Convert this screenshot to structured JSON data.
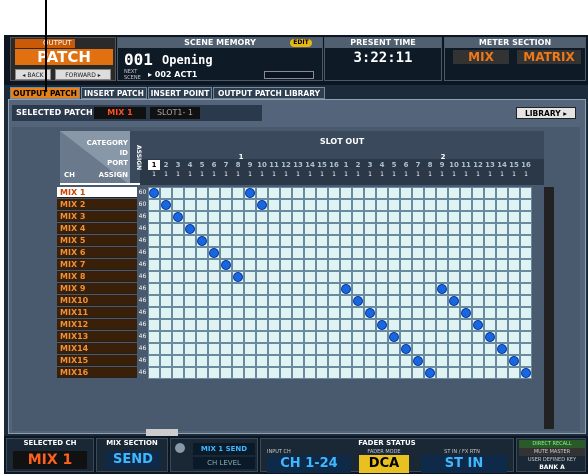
{
  "top": {
    "output_label": "OUTPUT",
    "output_title": "PATCH",
    "back_label": "◂ BACK",
    "forward_label": "FORWARD ▸",
    "scene_memory_label": "SCENE MEMORY",
    "edit_badge": "EDIT",
    "scene_number": "001",
    "scene_name": "Opening",
    "next_scene_label": "NEXT SCENE",
    "next_scene_value": "▸ 002 ACT1",
    "present_time_label": "PRESENT TIME",
    "present_time_value": "3:22:11",
    "meter_section_label": "METER SECTION",
    "meter_mix": "MIX",
    "meter_matrix": "MATRIX"
  },
  "tabs": [
    "OUTPUT PATCH",
    "INSERT PATCH",
    "INSERT POINT",
    "OUTPUT PATCH LIBRARY"
  ],
  "selected_patch": {
    "label": "SELECTED PATCH",
    "mix": "MIX 1",
    "slot": "SLOT1- 1",
    "library_button": "LIBRARY ▸"
  },
  "grid": {
    "header_labels": [
      "CATEGORY",
      "ID",
      "PORT",
      "ASSIGN"
    ],
    "ch_label": "CH",
    "assign_label": "ASSIGN",
    "slot_out_label": "SLOT OUT",
    "slot_ids": [
      "1",
      "2"
    ],
    "port_numbers": [
      "1",
      "2",
      "3",
      "4",
      "5",
      "6",
      "7",
      "8",
      "9",
      "10",
      "11",
      "12",
      "13",
      "14",
      "15",
      "16",
      "1",
      "2",
      "3",
      "4",
      "5",
      "6",
      "7",
      "8",
      "9",
      "10",
      "11",
      "12",
      "13",
      "14",
      "15",
      "16"
    ],
    "port_assigns": [
      "1",
      "1",
      "1",
      "1",
      "1",
      "1",
      "1",
      "1",
      "1",
      "1",
      "1",
      "1",
      "1",
      "1",
      "1",
      "1",
      "1",
      "1",
      "1",
      "1",
      "1",
      "1",
      "1",
      "1",
      "1",
      "1",
      "1",
      "1",
      "1",
      "1",
      "1",
      "1"
    ],
    "rows": [
      {
        "label": "MIX 1",
        "val": "60"
      },
      {
        "label": "MIX 2",
        "val": "60"
      },
      {
        "label": "MIX 3",
        "val": "46"
      },
      {
        "label": "MIX 4",
        "val": "46"
      },
      {
        "label": "MIX 5",
        "val": "46"
      },
      {
        "label": "MIX 6",
        "val": "46"
      },
      {
        "label": "MIX 7",
        "val": "46"
      },
      {
        "label": "MIX 8",
        "val": "46"
      },
      {
        "label": "MIX 9",
        "val": "46"
      },
      {
        "label": "MIX10",
        "val": "46"
      },
      {
        "label": "MIX11",
        "val": "46"
      },
      {
        "label": "MIX12",
        "val": "46"
      },
      {
        "label": "MIX13",
        "val": "46"
      },
      {
        "label": "MIX14",
        "val": "46"
      },
      {
        "label": "MIX15",
        "val": "46"
      },
      {
        "label": "MIX16",
        "val": "46"
      }
    ],
    "assignments": [
      [
        0,
        0
      ],
      [
        0,
        8
      ],
      [
        1,
        1
      ],
      [
        1,
        9
      ],
      [
        2,
        2
      ],
      [
        3,
        3
      ],
      [
        4,
        4
      ],
      [
        5,
        5
      ],
      [
        6,
        6
      ],
      [
        7,
        7
      ],
      [
        8,
        16
      ],
      [
        9,
        17
      ],
      [
        10,
        18
      ],
      [
        11,
        19
      ],
      [
        12,
        20
      ],
      [
        13,
        21
      ],
      [
        14,
        22
      ],
      [
        15,
        23
      ],
      [
        8,
        24
      ],
      [
        9,
        25
      ],
      [
        10,
        26
      ],
      [
        11,
        27
      ],
      [
        12,
        28
      ],
      [
        13,
        29
      ],
      [
        14,
        30
      ],
      [
        15,
        31
      ]
    ]
  },
  "bottom": {
    "selected_ch_label": "SELECTED CH",
    "selected_ch_value": "MIX 1",
    "mix_section_label": "MIX SECTION",
    "mix_section_value": "SEND",
    "mix1_send": "MIX 1 SEND",
    "ch_level": "CH LEVEL",
    "fader_status_label": "FADER STATUS",
    "input_ch_label": "INPUT CH",
    "input_ch_value": "CH 1-24",
    "fader_mode_label": "FADER MODE",
    "fader_mode_value": "DCA",
    "st_in_label": "ST IN / FX RTN",
    "st_in_value": "ST IN",
    "direct_recall": "DIRECT RECALL",
    "mute_master": "MUTE MASTER",
    "user_defined": "USER DEFINED KEY",
    "bank": "BANK A"
  },
  "colors": {
    "accent": "#e88018",
    "dot": "#1a66e0",
    "grid_bg": "#dff3f3"
  }
}
